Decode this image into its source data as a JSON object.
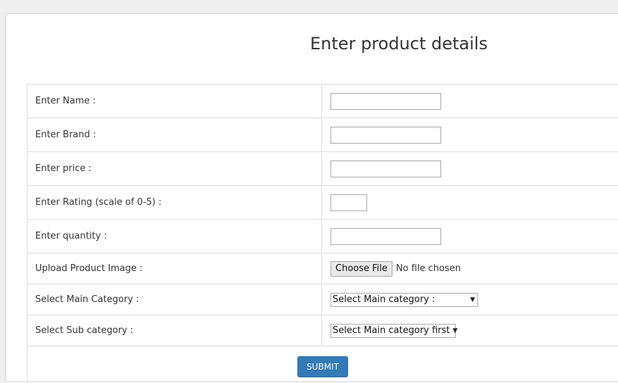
{
  "page": {
    "title": "Enter product details"
  },
  "form": {
    "fields": [
      {
        "label": "Enter Name :",
        "value": ""
      },
      {
        "label": "Enter Brand :",
        "value": ""
      },
      {
        "label": "Enter price :",
        "value": ""
      },
      {
        "label": "Enter Rating (scale of 0-5) :",
        "value": ""
      },
      {
        "label": "Enter quantity :",
        "value": ""
      }
    ],
    "upload": {
      "label": "Upload Product Image :",
      "button": "Choose File",
      "status": "No file chosen"
    },
    "main_category": {
      "label": "Select Main Category :",
      "selected": "Select Main category :"
    },
    "sub_category": {
      "label": "Select Sub category :",
      "selected": "Select Main category first"
    },
    "submit_label": "SUBMIT"
  },
  "colors": {
    "button_primary": "#337ab7",
    "background": "#efefef",
    "border": "#dddddd"
  }
}
